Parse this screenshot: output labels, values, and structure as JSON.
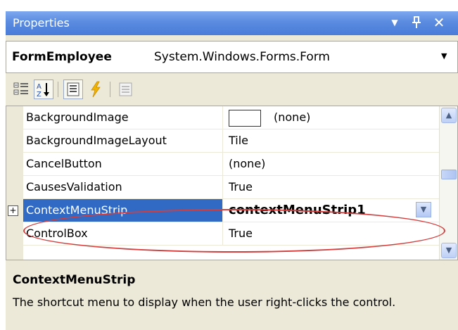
{
  "window": {
    "title": "Properties",
    "controls": {
      "dropdown": "▼",
      "pin": "ᵠ",
      "close": "✕"
    }
  },
  "object_selector": {
    "name": "FormEmployee",
    "type": "System.Windows.Forms.Form"
  },
  "toolbar": {
    "buttons": [
      {
        "icon": "categorized-icon",
        "checked": false
      },
      {
        "icon": "alphabetical-sort-icon",
        "checked": true
      },
      {
        "icon": "properties-icon",
        "checked": true
      },
      {
        "icon": "events-lightning-icon",
        "checked": false
      },
      {
        "icon": "property-pages-icon",
        "checked": false
      }
    ]
  },
  "properties": [
    {
      "name": "BackgroundImage",
      "value": "(none)",
      "swatch": true
    },
    {
      "name": "BackgroundImageLayout",
      "value": "Tile"
    },
    {
      "name": "CancelButton",
      "value": "(none)"
    },
    {
      "name": "CausesValidation",
      "value": "True"
    },
    {
      "name": "ContextMenuStrip",
      "value": "contextMenuStrip1",
      "selected": true,
      "expandable": true
    },
    {
      "name": "ControlBox",
      "value": "True"
    }
  ],
  "description": {
    "title": "ContextMenuStrip",
    "text": "The shortcut menu to display when the user right-clicks the control."
  },
  "colors": {
    "title_bar": "#5a8be0",
    "selection": "#316ac5",
    "panel_bg": "#ece9d8",
    "annotation": "#d23d3d"
  }
}
